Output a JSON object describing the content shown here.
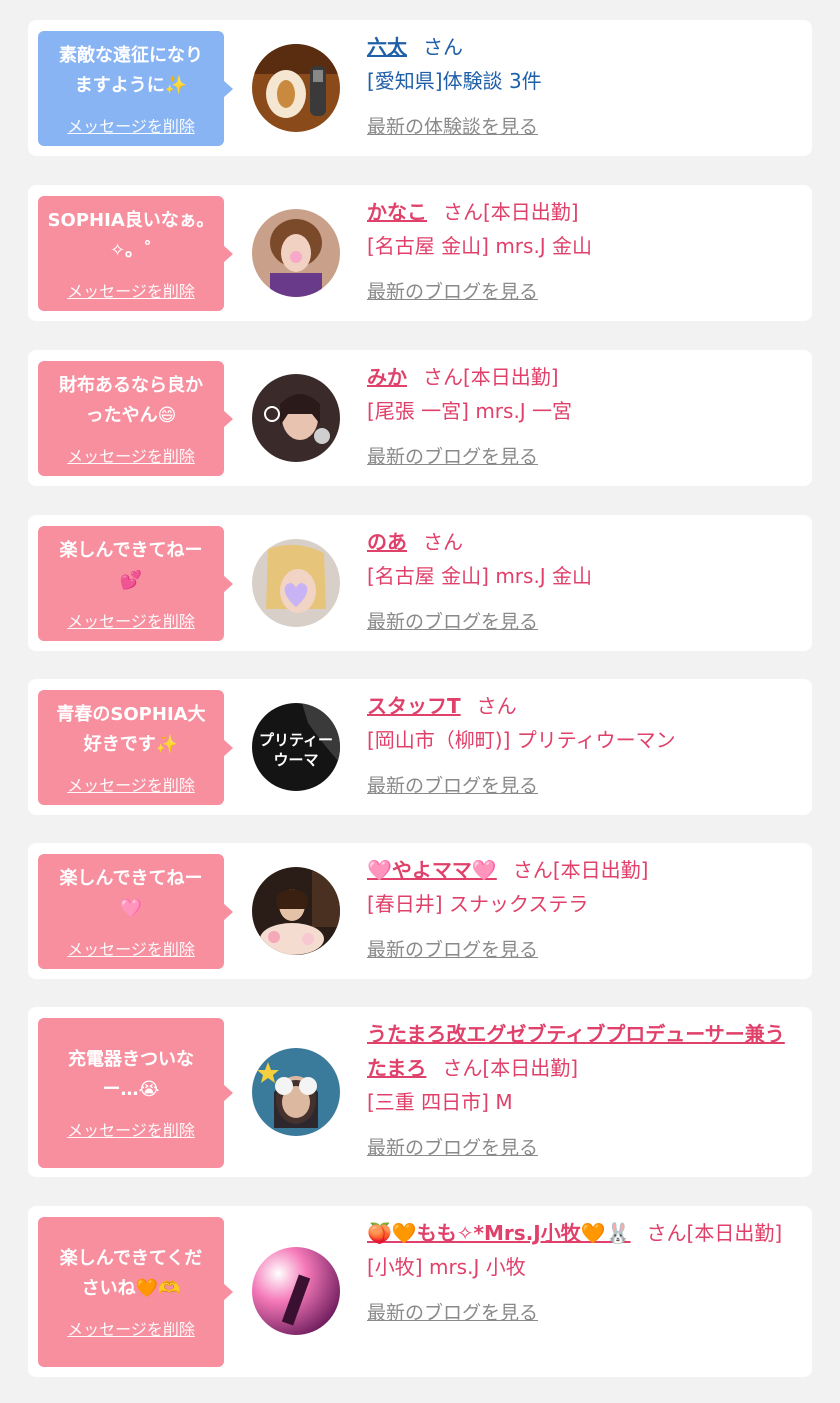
{
  "san": "さん",
  "delete_label": "メッセージを削除",
  "colors": {
    "blue": "#1f5fa8",
    "pink": "#e0416a",
    "bubble_blue": "#88b4f4",
    "bubble_pink": "#f78f9f",
    "link_gray": "#8a8a8a"
  },
  "entries": [
    {
      "message": "素敵な遠征になり\nますように✨",
      "name": "六太",
      "status": "",
      "area": "[愛知県]体験談 3件",
      "more": "最新の体験談を見る",
      "theme": "blue",
      "avatar_icon": "food-photo"
    },
    {
      "message": "SOPHIA良いなぁ。\n✧。˚",
      "name": "かなこ",
      "status": "[本日出勤]",
      "area": "[名古屋 金山] mrs.J 金山",
      "more": "最新のブログを見る",
      "theme": "pink",
      "avatar_icon": "woman-photo"
    },
    {
      "message": "財布あるなら良か\nったやん😄",
      "name": "みか",
      "status": "[本日出勤]",
      "area": "[尾張 一宮] mrs.J 一宮",
      "more": "最新のブログを見る",
      "theme": "pink",
      "avatar_icon": "selfie-photo"
    },
    {
      "message": "楽しんできてねー\n💕",
      "name": "のあ",
      "status": "",
      "area": "[名古屋 金山] mrs.J 金山",
      "more": "最新のブログを見る",
      "theme": "pink",
      "avatar_icon": "heart-sticker-photo"
    },
    {
      "message": "青春のSOPHIA大\n好きです✨",
      "name": "スタッフT",
      "status": "",
      "area": "[岡山市（柳町)] プリティウーマン",
      "more": "最新のブログを見る",
      "theme": "pink",
      "avatar_icon": "shop-logo",
      "avatar_text": "プリティー\nウーマ"
    },
    {
      "message": "楽しんできてねー\n🩷",
      "name": "🩷やよママ🩷",
      "status": "[本日出勤]",
      "area": "[春日井] スナックステラ",
      "more": "最新のブログを見る",
      "theme": "pink",
      "avatar_icon": "woman-flowers-photo"
    },
    {
      "message": "充電器きついな\nー…😭",
      "name": "うたまろ改エグゼブティブプロデューサー兼うたまろ",
      "status": "[本日出勤]",
      "area": "[三重 四日市] M",
      "more": "最新のブログを見る",
      "theme": "pink",
      "avatar_icon": "sunglasses-photo"
    },
    {
      "message": "楽しんできてくだ\nさいね🧡🫶",
      "name": "🍑🧡もも✧*Mrs.J小牧🧡🐰",
      "status": "[本日出勤]",
      "area": "[小牧] mrs.J 小牧",
      "more": "最新のブログを見る",
      "theme": "pink",
      "avatar_icon": "pink-light-photo"
    }
  ]
}
